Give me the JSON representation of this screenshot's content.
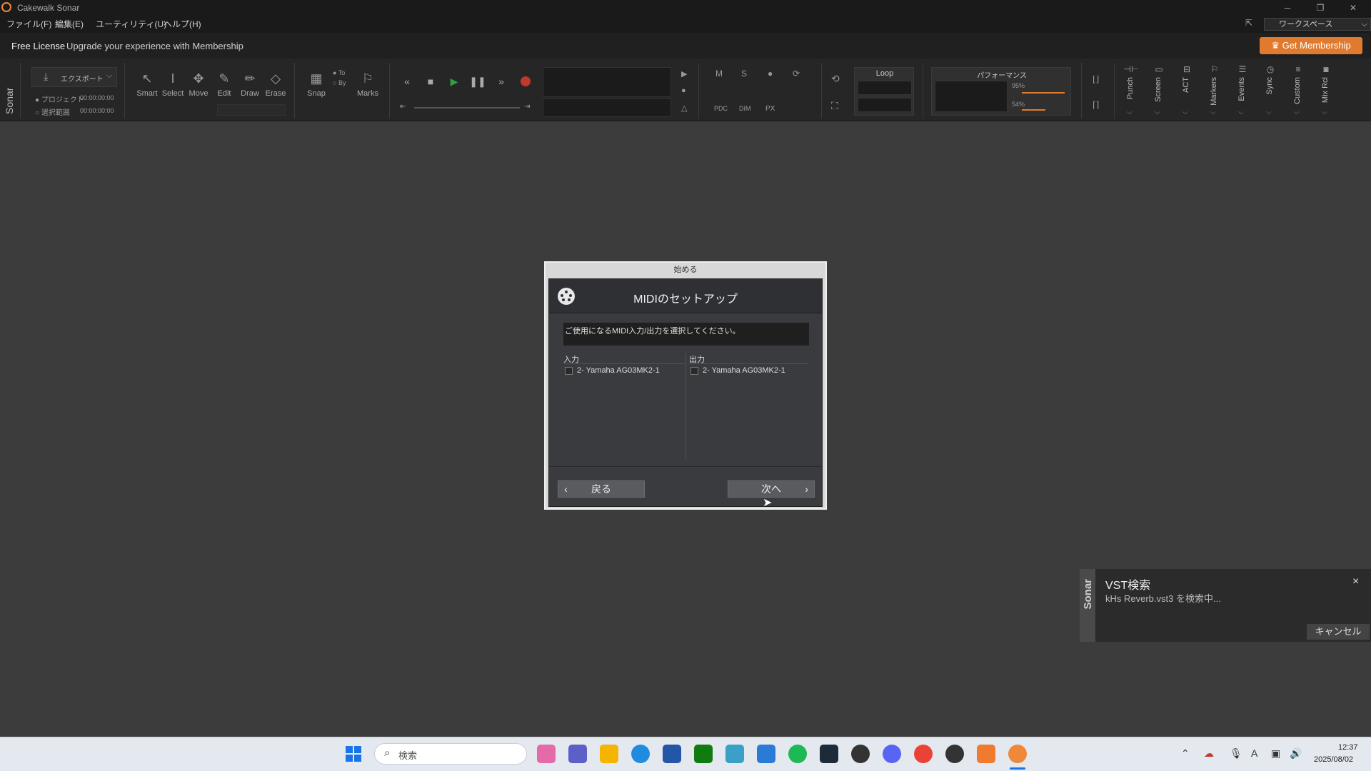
{
  "titlebar": {
    "title": "Cakewalk Sonar",
    "minimize": "─",
    "restore": "❐",
    "close": "✕"
  },
  "menu": {
    "file": "ファイル(F)",
    "edit": "編集(E)",
    "utility": "ユーティリティ(U)",
    "help": "ヘルプ(H)",
    "workspace": "ワークスペース",
    "workspace_caret": "⌵"
  },
  "license": {
    "label": "Free License",
    "message": "Upgrade your experience with Membership",
    "button": "Get Membership"
  },
  "control": {
    "brand": "Sonar",
    "export_label": "エクスポート",
    "project_label": "プロジェクト",
    "project_time": "00:00:00:00",
    "selection_label": "選択範囲",
    "selection_time": "00:00:00:00",
    "tools": [
      "Smart",
      "Select",
      "Move",
      "Edit",
      "Draw",
      "Erase"
    ],
    "snap": "Snap",
    "snap_to": "To",
    "snap_by": "By",
    "marks": "Marks",
    "mix": {
      "m": "M",
      "s": "S",
      "pdc": "PDC",
      "dim": "DIM",
      "px": "PX"
    },
    "loop": "Loop",
    "performance": "パフォーマンス",
    "cpu": "95%",
    "disk": "54%",
    "right_tools": [
      "Punch",
      "Screen",
      "ACT",
      "Markers",
      "Events",
      "Sync",
      "Custom",
      "Mix Rcl"
    ]
  },
  "dialog": {
    "caption": "始める",
    "title": "MIDIのセットアップ",
    "prompt": "ご使用になるMIDI入力/出力を選択してください。",
    "input_header": "入力",
    "output_header": "出力",
    "input_device": "2- Yamaha AG03MK2-1",
    "output_device": "2- Yamaha AG03MK2-1",
    "back": "戻る",
    "next": "次へ"
  },
  "toast": {
    "brand": "Sonar",
    "title": "VST検索",
    "message": "kHs Reverb.vst3 を検索中...",
    "cancel": "キャンセル",
    "close": "×"
  },
  "taskbar": {
    "search_placeholder": "検索",
    "time": "12:37",
    "date": "2025/08/02",
    "ime": "A"
  },
  "colors": {
    "accent": "#e07a2e",
    "record": "#c0392b",
    "play": "#2ea043"
  }
}
